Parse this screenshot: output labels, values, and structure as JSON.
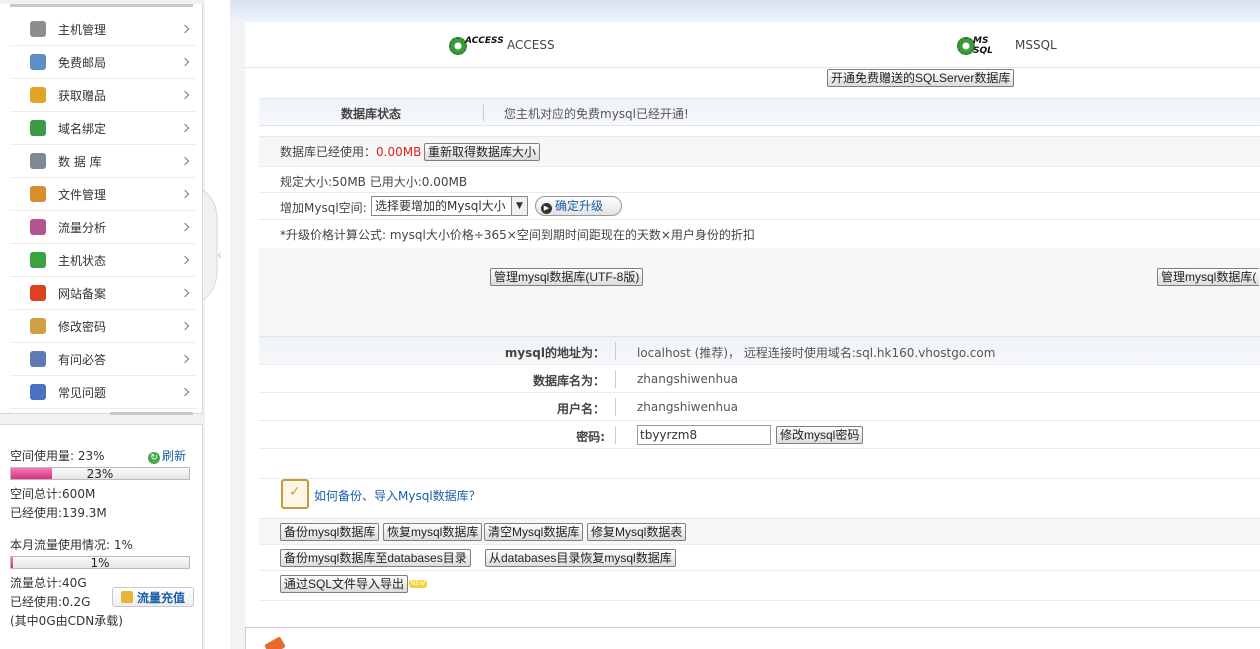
{
  "sidebar": {
    "menu": [
      {
        "label": "主机管理",
        "icon": "server-icon",
        "color": "#8d8d8d"
      },
      {
        "label": "免费邮局",
        "icon": "mail-icon",
        "color": "#5e8ec4"
      },
      {
        "label": "获取赠品",
        "icon": "gift-icon",
        "color": "#e0a526"
      },
      {
        "label": "域名绑定",
        "icon": "globe-icon",
        "color": "#3e9a48"
      },
      {
        "label": "数 据 库",
        "icon": "database-icon",
        "color": "#7f8a96"
      },
      {
        "label": "文件管理",
        "icon": "folder-icon",
        "color": "#d98d2b"
      },
      {
        "label": "流量分析",
        "icon": "chart-icon",
        "color": "#b4548f"
      },
      {
        "label": "主机状态",
        "icon": "status-icon",
        "color": "#3ba340"
      },
      {
        "label": "网站备案",
        "icon": "record-icon",
        "color": "#e04020"
      },
      {
        "label": "修改密码",
        "icon": "key-icon",
        "color": "#d0a040"
      },
      {
        "label": "有问必答",
        "icon": "user-question-icon",
        "color": "#5f79b4"
      },
      {
        "label": "常见问题",
        "icon": "faq-icon",
        "color": "#4a73c6"
      }
    ],
    "stats": {
      "space_usage": "空间使用量: 23%",
      "refresh": "刷新",
      "space_bar_percent": 23,
      "space_bar_text": "23%",
      "space_total": "空间总计:600M",
      "space_used": "已经使用:139.3M",
      "traffic_usage": "本月流量使用情况: 1%",
      "traffic_bar_percent": 1,
      "traffic_bar_text": "1%",
      "traffic_total": "流量总计:40G",
      "traffic_used": "已经使用:0.2G",
      "cdn_note": "(其中0G由CDN承载)",
      "recharge": "流量充值"
    }
  },
  "main": {
    "tabs": [
      {
        "label": "ACCESS",
        "icon_text": "ACCESS"
      },
      {
        "label": "MSSQL",
        "icon_text": "MS SQL"
      }
    ],
    "sqlserver_button": "开通免费赠送的SQLServer数据库",
    "status": {
      "label": "数据库状态",
      "value": "您主机对应的免费mysql已经开通!"
    },
    "size": {
      "used_prefix": "数据库已经使用：",
      "used_value": "0.00MB",
      "refresh_size_button": "重新取得数据库大小",
      "quota": "规定大小:50MB 已用大小:0.00MB",
      "add_space_label": "增加Mysql空间:",
      "add_space_select": "选择要增加的Mysql大小",
      "upgrade_button": "确定升级",
      "formula": "*升级价格计算公式: mysql大小价格÷365×空间到期时间距现在的天数×用户身份的折扣"
    },
    "manage_utf8_button": "管理mysql数据库(UTF-8版)",
    "manage_other_button": "管理mysql数据库(",
    "connection": {
      "address_label": "mysql的地址为：",
      "address_value": "localhost (推荐)， 远程连接时使用域名:sql.hk160.vhostgo.com",
      "dbname_label": "数据库名为：",
      "dbname_value": "zhangshiwenhua",
      "username_label": "用户名：",
      "username_value": "zhangshiwenhua",
      "password_label": "密码:",
      "password_value": "tbyyrzm8",
      "change_password_button": "修改mysql密码"
    },
    "howto_link": "如何备份、导入Mysql数据库？",
    "operations": {
      "backup": "备份mysql数据库",
      "restore": "恢复mysql数据库",
      "clear": "清空Mysql数据库",
      "repair": "修复Mysql数据表",
      "backup_to_dir": "备份mysql数据库至databases目录",
      "restore_from_dir": "从databases目录恢复mysql数据库",
      "import_export": "通过SQL文件导入导出",
      "new_badge": "NEW"
    }
  }
}
